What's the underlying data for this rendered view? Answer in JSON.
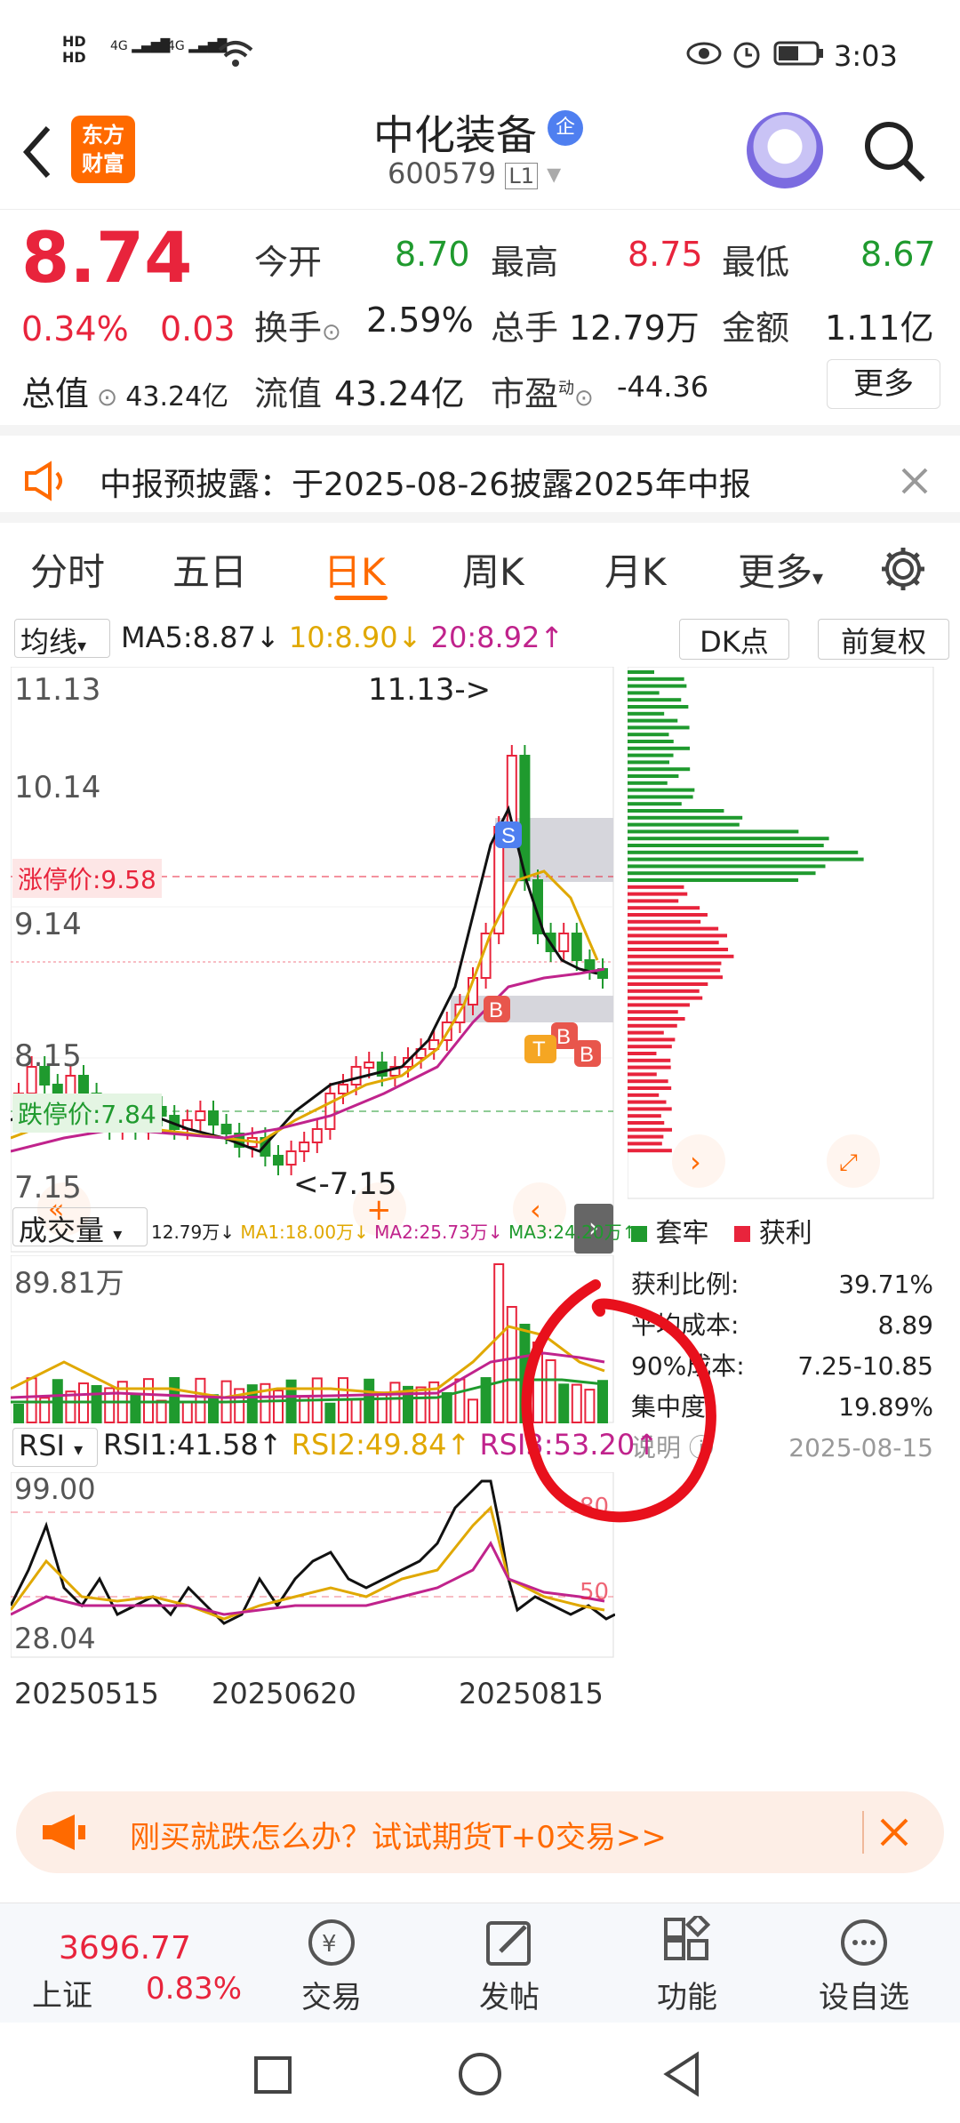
{
  "status_bar": {
    "hd1": "HD",
    "hd2": "HD",
    "net1": "4G",
    "net2": "4G",
    "time": "3:03"
  },
  "header": {
    "logo_line1": "东方",
    "logo_line2": "财富",
    "stock_name": "中化装备",
    "badge": "企",
    "stock_code": "600579",
    "level": "L1"
  },
  "quote": {
    "price": "8.74",
    "change_pct": "0.34%",
    "change_abs": "0.03",
    "total_value_label": "总值",
    "total_value": "43.24亿",
    "open_label": "今开",
    "open": "8.70",
    "high_label": "最高",
    "high": "8.75",
    "low_label": "最低",
    "low": "8.67",
    "turnover_label": "换手",
    "turnover": "2.59%",
    "volume_label": "总手",
    "volume": "12.79万",
    "amount_label": "金额",
    "amount": "1.11亿",
    "float_label": "流值",
    "float_value": "43.24亿",
    "pe_label": "市盈",
    "pe_sup": "动",
    "pe": "-44.36",
    "more": "更多"
  },
  "notice": {
    "text": "中报预披露：于2025-08-26披露2025年中报"
  },
  "tabs": [
    "分时",
    "五日",
    "日K",
    "周K",
    "月K",
    "更多"
  ],
  "kline": {
    "ma_select": "均线",
    "ma5": "MA5:8.87",
    "ma10": "10:8.90",
    "ma20": "20:8.92",
    "dk": "DK点",
    "fq": "前复权",
    "y_top": "11.13",
    "y2": "10.14",
    "y3": "9.14",
    "y4": "8.15",
    "y_bottom": "7.15",
    "limit_up": "涨停价:9.58",
    "limit_down": "跌停价:7.84",
    "max_marker": "11.13->",
    "min_marker": "<-7.15"
  },
  "chip": {
    "legend_trap": "套牢",
    "legend_profit": "获利",
    "rows": [
      {
        "label": "获利比例:",
        "value": "39.71%"
      },
      {
        "label": "平均成本:",
        "value": "8.89"
      },
      {
        "label": "90%成本:",
        "value": "7.25-10.85"
      },
      {
        "label": "集中度:",
        "value": "19.89%"
      }
    ],
    "explain": "说明",
    "date": "2025-08-15"
  },
  "volume": {
    "select": "成交量",
    "v": "12.79万",
    "ma1": "MA1:18.00万",
    "ma2": "MA2:25.73万",
    "ma3": "MA3:24.20万",
    "max": "89.81万"
  },
  "rsi": {
    "select": "RSI",
    "rsi1": "RSI1:41.58",
    "rsi2": "RSI2:49.84",
    "rsi3": "RSI3:53.20",
    "top": "99.00",
    "bottom": "28.04",
    "l80": "80",
    "l50": "50",
    "dates": [
      "20250515",
      "20250620",
      "20250815"
    ]
  },
  "banner": {
    "text": "刚买就跌怎么办？试试期货T+0交易>>"
  },
  "bottom": {
    "index_value": "3696.77",
    "index_name": "上证",
    "index_change": "0.83%",
    "items": [
      "交易",
      "发帖",
      "功能",
      "设自选"
    ]
  },
  "colors": {
    "up": "#e8243c",
    "down": "#1f9a2e",
    "accent": "#ff6a00"
  }
}
